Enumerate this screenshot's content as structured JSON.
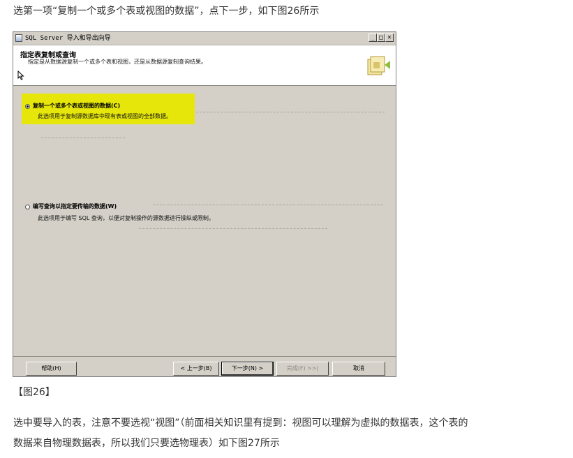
{
  "article": {
    "intro": "选第一项“复制一个或多个表或视图的数据”，点下一步，如下图26所示",
    "caption": "【图26】",
    "next_para_line1": "选中要导入的表，注意不要选视“视图”（前面相关知识里有提到：视图可以理解为虚拟的数据表，这个表的",
    "next_para_line2": "数据来自物理数据表，所以我们只要选物理表）如下图27所示"
  },
  "window": {
    "title": "SQL Server 导入和导出向导",
    "controls": {
      "minimize": "_",
      "maximize": "□",
      "close": "×"
    },
    "header": {
      "title": "指定表复制或查询",
      "description": "指定是从数据源复制一个或多个表和视图，还是从数据源复制查询结果。"
    },
    "options": [
      {
        "label": "复制一个或多个表或视图的数据(C)",
        "description": "此选项用于复制源数据库中现有表或视图的全部数据。",
        "selected": true
      },
      {
        "label": "编写查询以指定要传输的数据(W)",
        "description": "此选项用于编写 SQL 查询，以便对复制操作的源数据进行操纵或限制。",
        "selected": false
      }
    ],
    "buttons": {
      "help": "帮助(H)",
      "back": "< 上一步(B)",
      "next": "下一步(N) >",
      "finish": "完成(F) >>|",
      "cancel": "取消"
    },
    "colors": {
      "highlight": "#e6e60b",
      "dialog_bg": "#d4d0c8",
      "header_bg": "#ffffff"
    }
  }
}
